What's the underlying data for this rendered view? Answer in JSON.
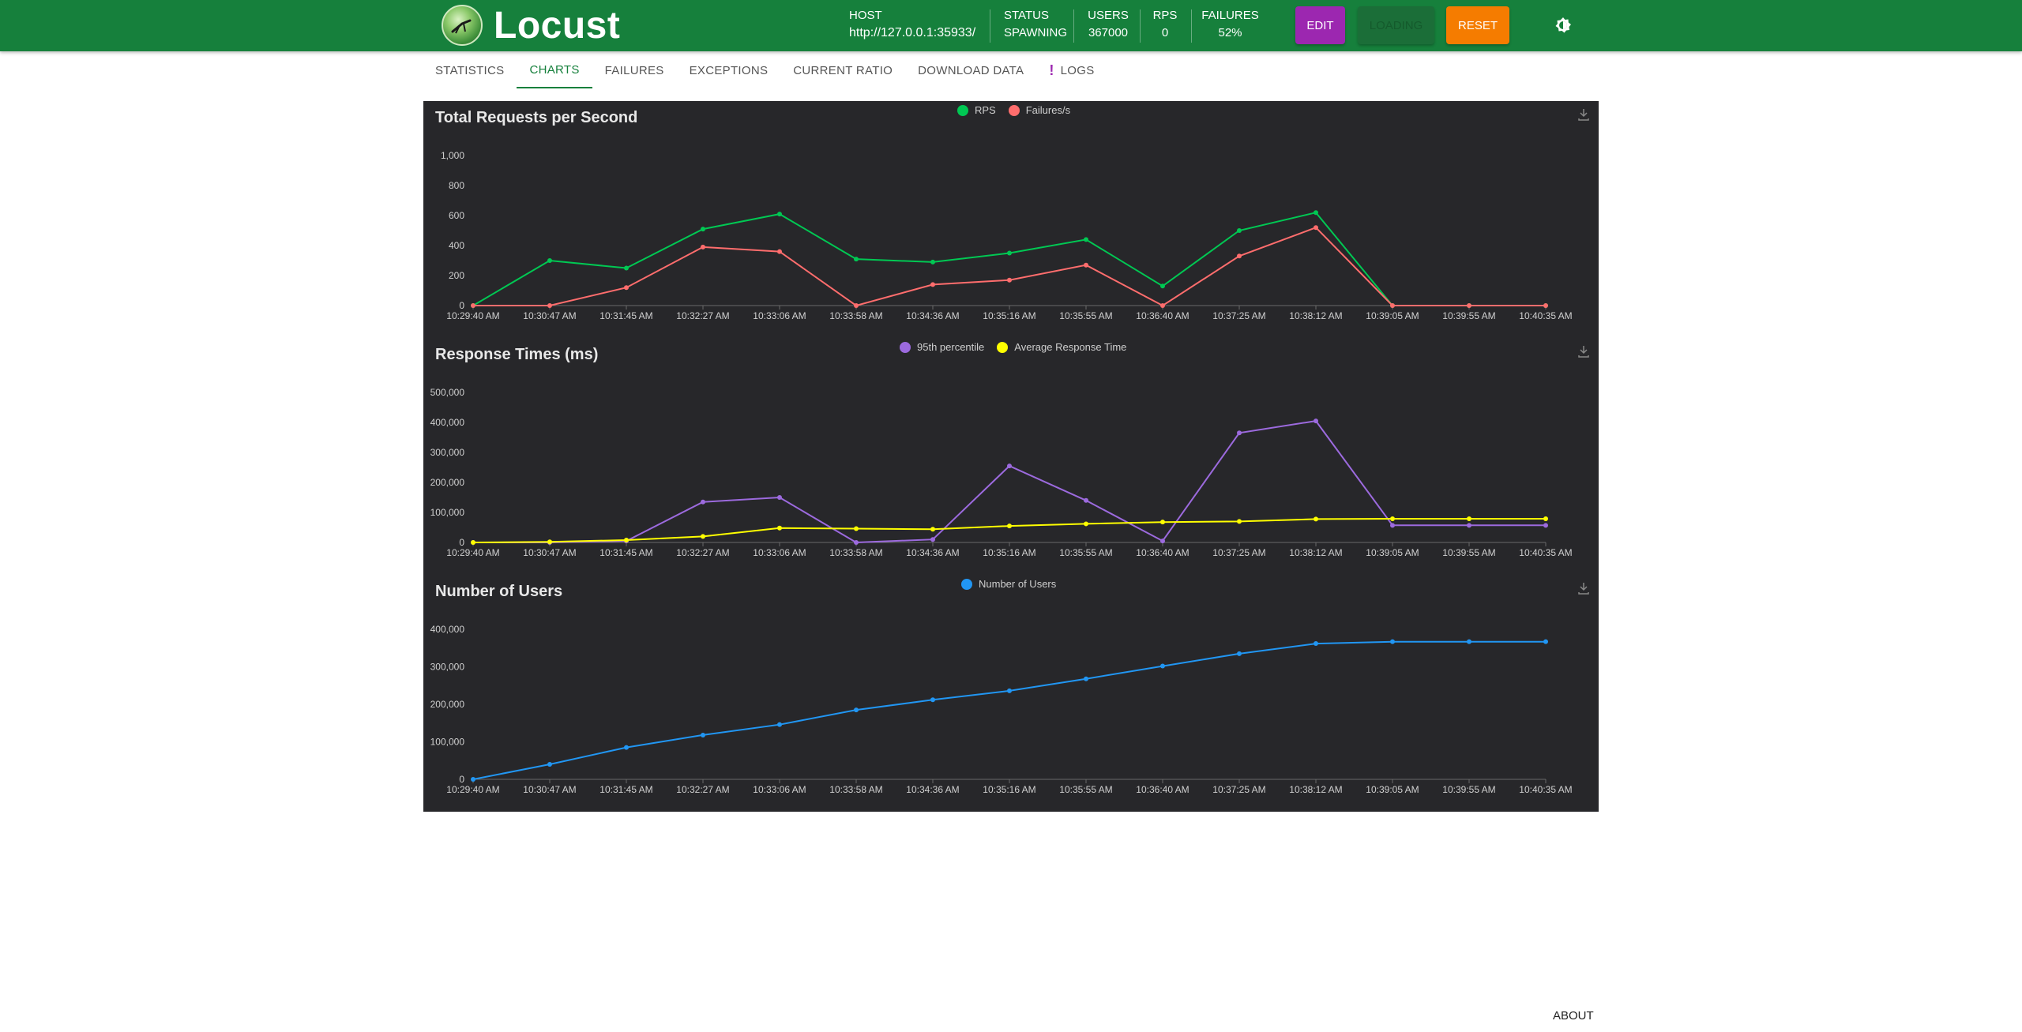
{
  "app": {
    "name": "Locust"
  },
  "header": {
    "host_label": "HOST",
    "host_value": "http://127.0.0.1:35933/",
    "status_label": "STATUS",
    "status_value": "SPAWNING",
    "users_label": "USERS",
    "users_value": "367000",
    "rps_label": "RPS",
    "rps_value": "0",
    "failures_label": "FAILURES",
    "failures_value": "52%",
    "edit_label": "EDIT",
    "loading_label": "LOADING",
    "reset_label": "RESET"
  },
  "tabs": [
    {
      "label": "STATISTICS"
    },
    {
      "label": "CHARTS"
    },
    {
      "label": "FAILURES"
    },
    {
      "label": "EXCEPTIONS"
    },
    {
      "label": "CURRENT RATIO"
    },
    {
      "label": "DOWNLOAD DATA"
    },
    {
      "label": "LOGS"
    }
  ],
  "footer": {
    "about_label": "ABOUT"
  },
  "colors": {
    "brand": "#16803c",
    "edit": "#9c27b0",
    "reset": "#f57c00",
    "rps": "#00c853",
    "failures": "#ff6d6d",
    "p95": "#9c6ade",
    "avg": "#ffff00",
    "users": "#2196f3",
    "chart_bg": "#27272a"
  },
  "chart_data": [
    {
      "type": "line",
      "title": "Total Requests per Second",
      "x": [
        "10:29:40 AM",
        "10:30:47 AM",
        "10:31:45 AM",
        "10:32:27 AM",
        "10:33:06 AM",
        "10:33:58 AM",
        "10:34:36 AM",
        "10:35:16 AM",
        "10:35:55 AM",
        "10:36:40 AM",
        "10:37:25 AM",
        "10:38:12 AM",
        "10:39:05 AM",
        "10:39:55 AM",
        "10:40:35 AM"
      ],
      "yticks": [
        "0",
        "200",
        "400",
        "600",
        "800",
        "1,000"
      ],
      "ylim": [
        0,
        1000
      ],
      "series": [
        {
          "name": "RPS",
          "values": [
            0,
            300,
            250,
            510,
            610,
            310,
            290,
            350,
            440,
            130,
            500,
            620,
            0,
            0,
            0
          ]
        },
        {
          "name": "Failures/s",
          "values": [
            0,
            0,
            120,
            390,
            360,
            0,
            140,
            170,
            270,
            0,
            330,
            520,
            0,
            0,
            0
          ]
        }
      ]
    },
    {
      "type": "line",
      "title": "Response Times (ms)",
      "x": [
        "10:29:40 AM",
        "10:30:47 AM",
        "10:31:45 AM",
        "10:32:27 AM",
        "10:33:06 AM",
        "10:33:58 AM",
        "10:34:36 AM",
        "10:35:16 AM",
        "10:35:55 AM",
        "10:36:40 AM",
        "10:37:25 AM",
        "10:38:12 AM",
        "10:39:05 AM",
        "10:39:55 AM",
        "10:40:35 AM"
      ],
      "yticks": [
        "0",
        "100,000",
        "200,000",
        "300,000",
        "400,000",
        "500,000"
      ],
      "ylim": [
        0,
        500000
      ],
      "series": [
        {
          "name": "95th percentile",
          "values": [
            0,
            0,
            5000,
            135000,
            150000,
            0,
            10000,
            255000,
            140000,
            5000,
            365000,
            405000,
            57000,
            57000,
            57000
          ]
        },
        {
          "name": "Average Response Time",
          "values": [
            0,
            2000,
            8000,
            20000,
            48000,
            46000,
            44000,
            55000,
            62000,
            68000,
            70000,
            78000,
            79000,
            79000,
            79000
          ]
        }
      ]
    },
    {
      "type": "line",
      "title": "Number of Users",
      "x": [
        "10:29:40 AM",
        "10:30:47 AM",
        "10:31:45 AM",
        "10:32:27 AM",
        "10:33:06 AM",
        "10:33:58 AM",
        "10:34:36 AM",
        "10:35:16 AM",
        "10:35:55 AM",
        "10:36:40 AM",
        "10:37:25 AM",
        "10:38:12 AM",
        "10:39:05 AM",
        "10:39:55 AM",
        "10:40:35 AM"
      ],
      "yticks": [
        "0",
        "100,000",
        "200,000",
        "300,000",
        "400,000"
      ],
      "ylim": [
        0,
        400000
      ],
      "series": [
        {
          "name": "Number of Users",
          "values": [
            0,
            40000,
            85000,
            118000,
            146000,
            185000,
            212000,
            236000,
            268000,
            302000,
            335000,
            362000,
            367000,
            367000,
            367000
          ]
        }
      ]
    }
  ]
}
